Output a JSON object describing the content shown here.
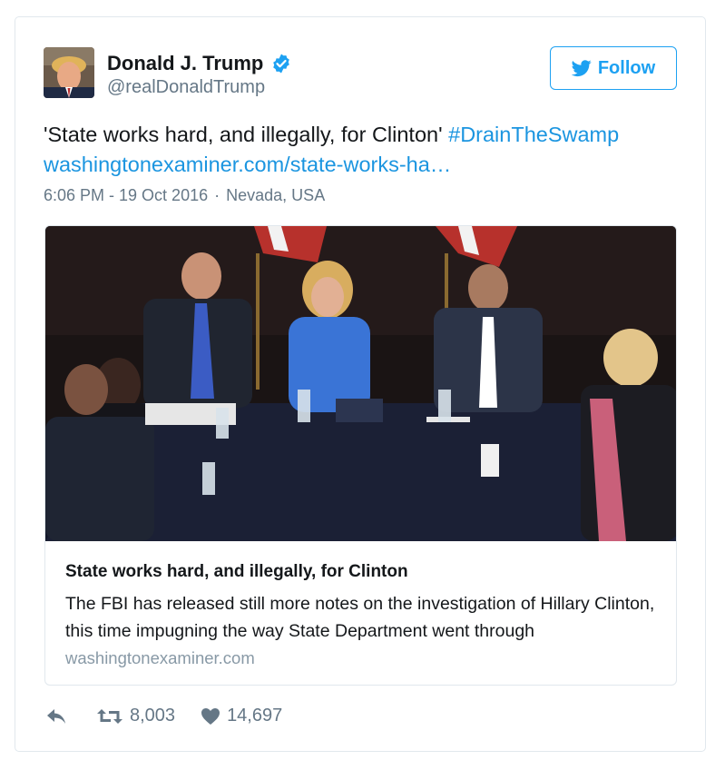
{
  "user": {
    "name": "Donald J. Trump",
    "handle": "@realDonaldTrump"
  },
  "follow_button": {
    "label": "Follow",
    "icon": "twitter-bird-icon"
  },
  "tweet": {
    "text_plain": "'State works hard, and illegally, for Clinton'",
    "hashtag": "#DrainTheSwamp",
    "link": "washingtonexaminer.com/state-works-ha…",
    "time": "6:06 PM - 19 Oct 2016",
    "separator": "·",
    "location": "Nevada, USA"
  },
  "card": {
    "title": "State works hard, and illegally, for Clinton",
    "description": "The FBI has released still more notes on the investigation of Hillary Clinton, this time impugning the way State Department went through",
    "domain": "washingtonexaminer.com"
  },
  "actions": {
    "retweets": "8,003",
    "likes": "14,697"
  },
  "colors": {
    "link": "#1b95e0",
    "follow": "#1da1f2",
    "verified": "#1da1f2",
    "muted": "#657786"
  }
}
